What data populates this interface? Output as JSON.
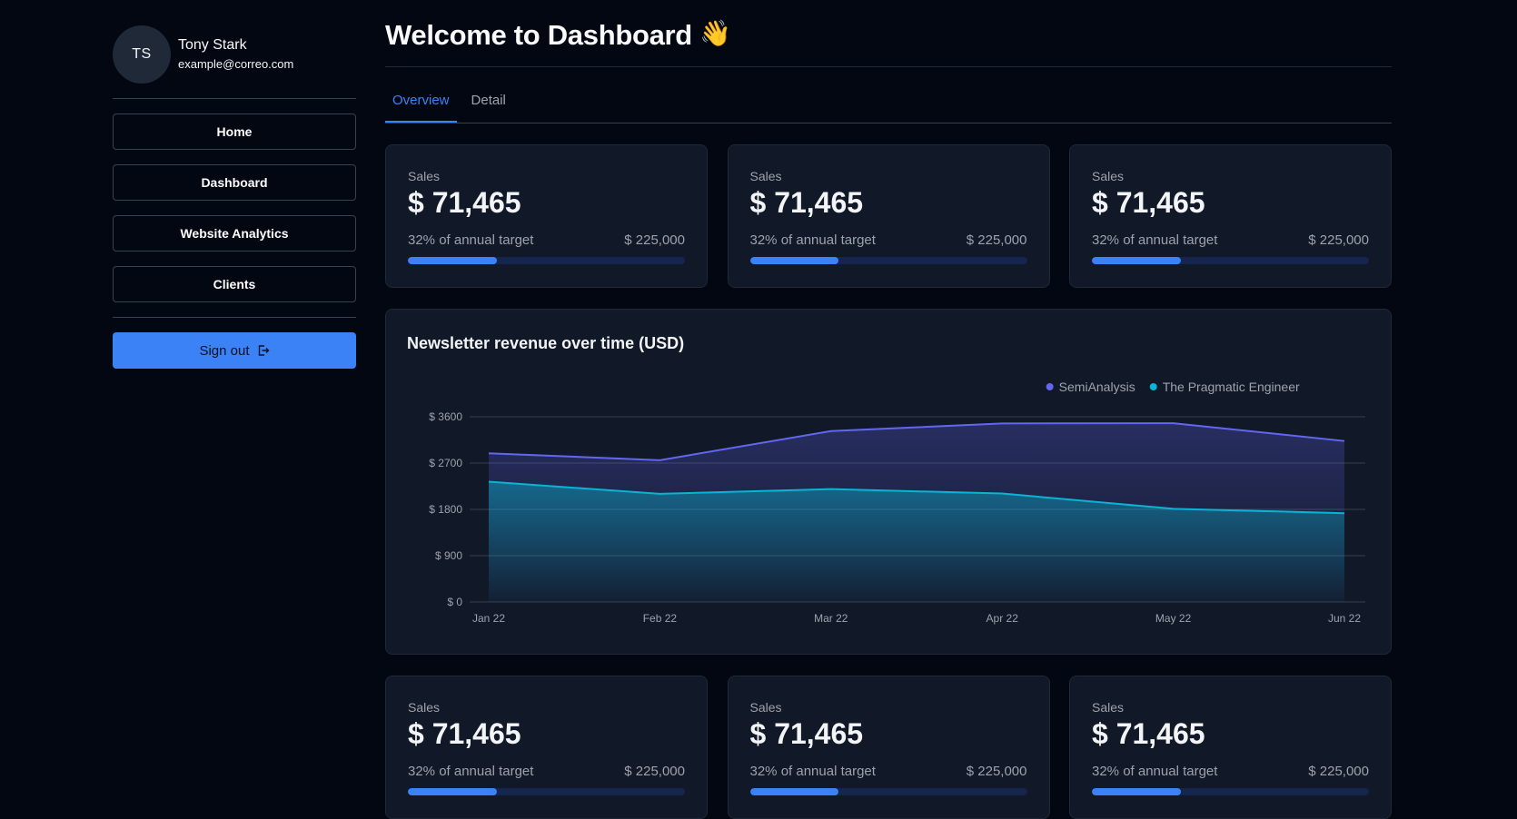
{
  "sidebar": {
    "avatar_initials": "TS",
    "user_name": "Tony Stark",
    "user_email": "example@correo.com",
    "nav": [
      {
        "label": "Home"
      },
      {
        "label": "Dashboard"
      },
      {
        "label": "Website Analytics"
      },
      {
        "label": "Clients"
      }
    ],
    "signout_label": "Sign out"
  },
  "header": {
    "title": "Welcome to Dashboard",
    "emoji": "👋"
  },
  "tabs": [
    {
      "label": "Overview",
      "active": true
    },
    {
      "label": "Detail",
      "active": false
    }
  ],
  "cards": [
    {
      "label": "Sales",
      "value": "$ 71,465",
      "target_text": "32% of annual target",
      "target_value": "$ 225,000",
      "progress": 0.32
    },
    {
      "label": "Sales",
      "value": "$ 71,465",
      "target_text": "32% of annual target",
      "target_value": "$ 225,000",
      "progress": 0.32
    },
    {
      "label": "Sales",
      "value": "$ 71,465",
      "target_text": "32% of annual target",
      "target_value": "$ 225,000",
      "progress": 0.32
    },
    {
      "label": "Sales",
      "value": "$ 71,465",
      "target_text": "32% of annual target",
      "target_value": "$ 225,000",
      "progress": 0.32
    },
    {
      "label": "Sales",
      "value": "$ 71,465",
      "target_text": "32% of annual target",
      "target_value": "$ 225,000",
      "progress": 0.32
    },
    {
      "label": "Sales",
      "value": "$ 71,465",
      "target_text": "32% of annual target",
      "target_value": "$ 225,000",
      "progress": 0.32
    }
  ],
  "colors": {
    "accent": "#3b82f6",
    "series_1": "#6366f1",
    "series_2": "#06b6d4"
  },
  "chart_data": {
    "type": "area",
    "title": "Newsletter revenue over time (USD)",
    "categories": [
      "Jan 22",
      "Feb 22",
      "Mar 22",
      "Apr 22",
      "May 22",
      "Jun 22"
    ],
    "series": [
      {
        "name": "SemiAnalysis",
        "color": "#6366f1",
        "values": [
          2890,
          2756,
          3322,
          3470,
          3475,
          3129
        ]
      },
      {
        "name": "The Pragmatic Engineer",
        "color": "#06b6d4",
        "values": [
          2338,
          2103,
          2194,
          2108,
          1812,
          1726
        ]
      }
    ],
    "ylim": [
      0,
      3600
    ],
    "yticks": [
      0,
      900,
      1800,
      2700,
      3600
    ],
    "ytick_labels": [
      "$ 0",
      "$ 900",
      "$ 1800",
      "$ 2700",
      "$ 3600"
    ],
    "grid": true,
    "legend": "top-right"
  }
}
